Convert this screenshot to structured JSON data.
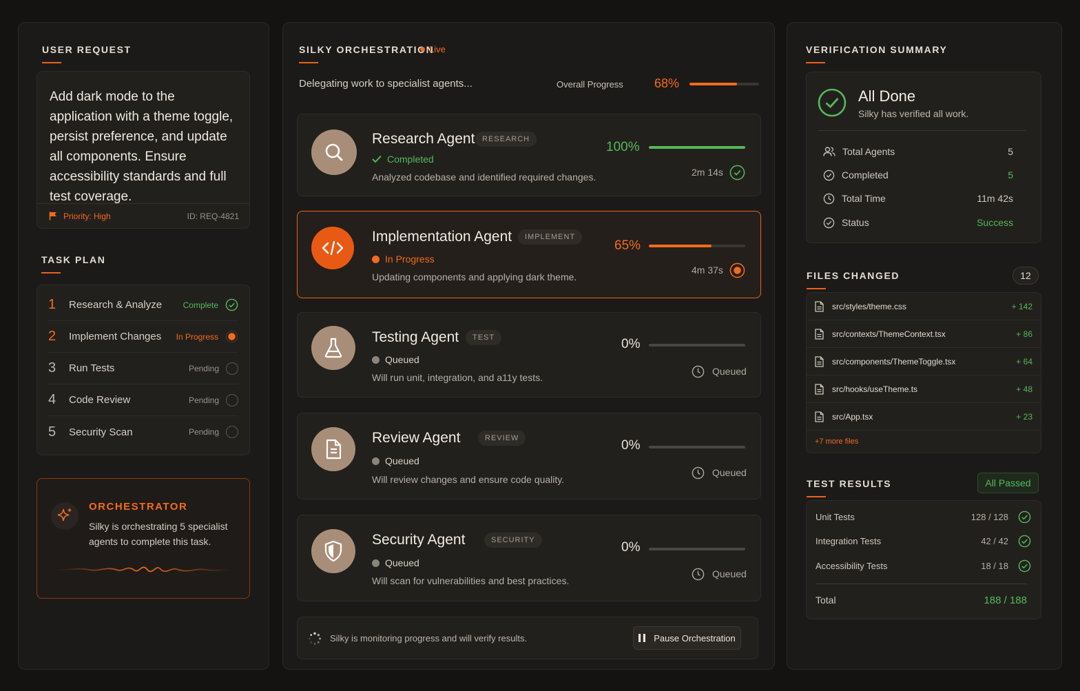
{
  "user_request": {
    "title": "USER REQUEST",
    "text": "Add dark mode to the application with a theme toggle, persist preference, and update all components. Ensure accessibility standards and full test coverage.",
    "priority": "Priority: High",
    "id": "ID: REQ-4821"
  },
  "task_plan": {
    "title": "TASK PLAN",
    "items": [
      {
        "num": "1",
        "label": "Research & Analyze",
        "status": "Complete"
      },
      {
        "num": "2",
        "label": "Implement Changes",
        "status": "In Progress"
      },
      {
        "num": "3",
        "label": "Run Tests",
        "status": "Pending"
      },
      {
        "num": "4",
        "label": "Code Review",
        "status": "Pending"
      },
      {
        "num": "5",
        "label": "Security Scan",
        "status": "Pending"
      }
    ]
  },
  "orchestrator": {
    "title": "ORCHESTRATOR",
    "text": "Silky is orchestrating 5 specialist agents to complete this task."
  },
  "orchestration": {
    "title": "SILKY ORCHESTRATION",
    "live": "Live",
    "subtitle": "Delegating work to specialist agents...",
    "overall_label": "Overall Progress",
    "overall_value": "68%",
    "overall_fraction": 0.68,
    "agents": [
      {
        "name": "Research Agent",
        "badge": "RESEARCH",
        "state": "Completed",
        "desc": "Analyzed codebase and identified required changes.",
        "pct": "100%",
        "progress": 1.0,
        "time": "2m 14s",
        "icon": "search-icon"
      },
      {
        "name": "Implementation Agent",
        "badge": "IMPLEMENT",
        "state": "In Progress",
        "desc": "Updating components and applying dark theme.",
        "pct": "65%",
        "progress": 0.65,
        "time": "4m 37s",
        "icon": "code-icon"
      },
      {
        "name": "Testing Agent",
        "badge": "TEST",
        "state": "Queued",
        "desc": "Will run unit, integration, and a11y tests.",
        "pct": "0%",
        "progress": 0,
        "time": "Queued",
        "icon": "flask-icon"
      },
      {
        "name": "Review Agent",
        "badge": "REVIEW",
        "state": "Queued",
        "desc": "Will review changes and ensure code quality.",
        "pct": "0%",
        "progress": 0,
        "time": "Queued",
        "icon": "document-icon"
      },
      {
        "name": "Security Agent",
        "badge": "SECURITY",
        "state": "Queued",
        "desc": "Will scan for vulnerabilities and best practices.",
        "pct": "0%",
        "progress": 0,
        "time": "Queued",
        "icon": "shield-icon"
      }
    ],
    "footer_text": "Silky is monitoring progress and will verify results.",
    "pause_label": "Pause Orchestration"
  },
  "verification": {
    "title": "VERIFICATION SUMMARY",
    "headline": "All Done",
    "subline": "Silky has verified all work.",
    "stats": [
      {
        "label": "Total Agents",
        "value": "5"
      },
      {
        "label": "Completed",
        "value": "5"
      },
      {
        "label": "Total Time",
        "value": "11m 42s"
      },
      {
        "label": "Status",
        "value": "Success"
      }
    ]
  },
  "files_changed": {
    "title": "FILES CHANGED",
    "count": "12",
    "files": [
      {
        "name": "src/styles/theme.css",
        "delta": "+ 142"
      },
      {
        "name": "src/contexts/ThemeContext.tsx",
        "delta": "+ 86"
      },
      {
        "name": "src/components/ThemeToggle.tsx",
        "delta": "+ 64"
      },
      {
        "name": "src/hooks/useTheme.ts",
        "delta": "+ 48"
      },
      {
        "name": "src/App.tsx",
        "delta": "+ 23"
      }
    ],
    "more": "+7 more files"
  },
  "test_results": {
    "title": "TEST RESULTS",
    "badge": "All Passed",
    "rows": [
      {
        "label": "Unit Tests",
        "value": "128 / 128"
      },
      {
        "label": "Integration Tests",
        "value": "42 / 42"
      },
      {
        "label": "Accessibility Tests",
        "value": "18 / 18"
      }
    ],
    "total_label": "Total",
    "total_value": "188 / 188"
  },
  "colors": {
    "accent": "#f26b1d",
    "success": "#56b85a",
    "panel": "#1c1a18",
    "background": "#141312"
  }
}
